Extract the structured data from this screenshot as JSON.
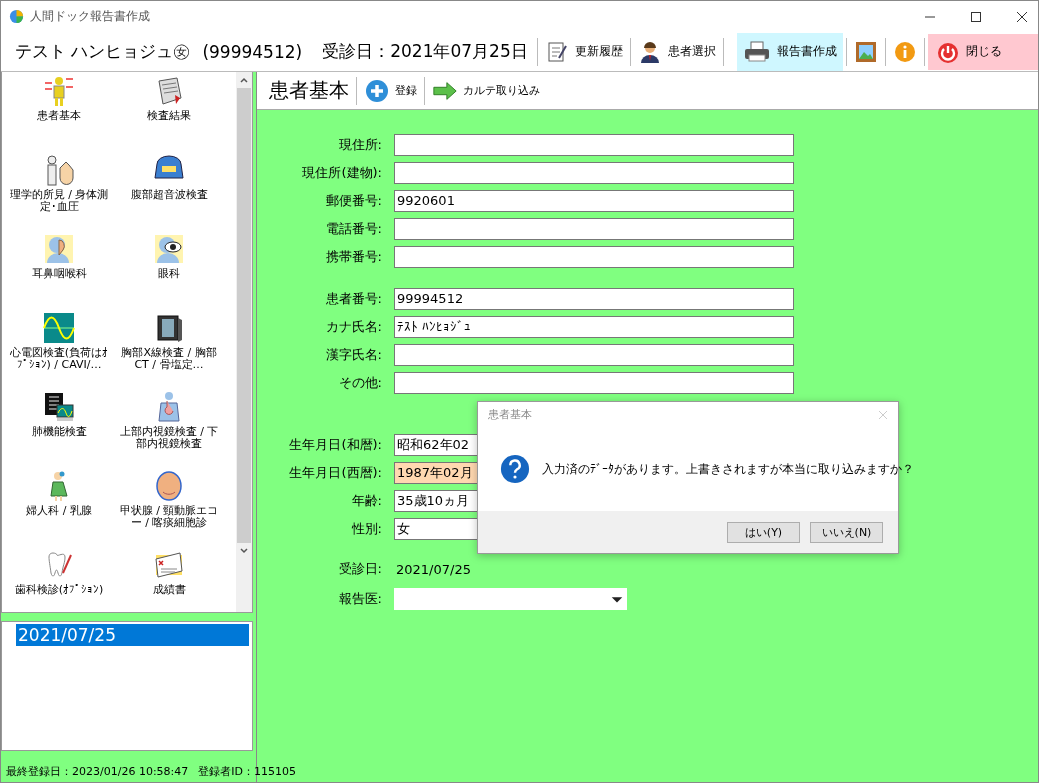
{
  "window": {
    "title": "人間ドック報告書作成"
  },
  "header": {
    "patient_name": "テスト ハンヒョジュ㊛",
    "patient_id": "(99994512)",
    "visit_date": "受診日：2021年07月25日",
    "buttons": [
      {
        "kind": "history",
        "label": "更新履歴"
      },
      {
        "kind": "patient",
        "label": "患者選択"
      },
      {
        "kind": "report",
        "label": "報告書作成"
      },
      {
        "kind": "picture"
      },
      {
        "kind": "info"
      },
      {
        "kind": "close",
        "label": "閉じる"
      }
    ]
  },
  "menu": [
    {
      "label": "患者基本"
    },
    {
      "label": "検査結果"
    },
    {
      "label": "理学的所見 / 身体測定･血圧"
    },
    {
      "label": "腹部超音波検査"
    },
    {
      "label": "耳鼻咽喉科"
    },
    {
      "label": "眼科"
    },
    {
      "label": "心電図検査(負荷はｵﾌﾟｼｮﾝ) / CAVI/…"
    },
    {
      "label": "胸部X線検査 / 胸部CT / 骨塩定…"
    },
    {
      "label": "肺機能検査"
    },
    {
      "label": "上部内視鏡検査 / 下部内視鏡検査"
    },
    {
      "label": "婦人科 / 乳腺"
    },
    {
      "label": "甲状腺 / 頸動脈エコー / 喀痰細胞診"
    },
    {
      "label": "歯科検診(ｵﾌﾟｼｮﾝ)"
    },
    {
      "label": "成績書"
    }
  ],
  "dates": [
    {
      "label": "2021/07/25",
      "selected": true
    }
  ],
  "status_bar": {
    "last_saved": "最終登録日：2023/01/26 10:58:47",
    "user_id": "登録者ID：115105"
  },
  "toolbar": {
    "title": "患者基本",
    "buttons": [
      {
        "kind": "add",
        "label": "登録"
      },
      {
        "kind": "import",
        "label": "カルテ取り込み"
      }
    ]
  },
  "form": {
    "sections": [
      [
        {
          "kind": "input",
          "label": "現住所:",
          "highlighted": false
        },
        {
          "kind": "input",
          "label": "現住所(建物):",
          "highlighted": false
        },
        {
          "kind": "input",
          "label": "郵便番号:",
          "value": "9920601",
          "highlighted": false
        },
        {
          "kind": "input",
          "label": "電話番号:",
          "highlighted": false
        },
        {
          "kind": "input",
          "label": "携帯番号:",
          "highlighted": false
        }
      ],
      [
        {
          "kind": "input",
          "label": "患者番号:",
          "value": "99994512",
          "highlighted": false
        },
        {
          "kind": "input",
          "label": "カナ氏名:",
          "value": "ﾃｽﾄ ﾊﾝﾋｮｼﾞｭ",
          "highlighted": false
        },
        {
          "kind": "input",
          "label": "漢字氏名:",
          "highlighted": false
        },
        {
          "kind": "input",
          "label": "その他:",
          "highlighted": false
        }
      ],
      [
        {
          "kind": "input",
          "label": "生年月日(和暦):",
          "value": "昭和62年02",
          "highlighted": false
        },
        {
          "kind": "input",
          "label": "生年月日(西暦):",
          "value": "1987年02月",
          "highlighted": true
        },
        {
          "kind": "input",
          "label": "年齢:",
          "value": "35歳10ヵ月",
          "highlighted": false
        },
        {
          "kind": "input",
          "label": "性別:",
          "value": "女",
          "highlighted": false
        }
      ],
      [
        {
          "kind": "text",
          "label": "受診日:",
          "value": "2021/07/25"
        }
      ],
      [
        {
          "kind": "select",
          "label": "報告医:"
        }
      ]
    ]
  },
  "dialog": {
    "title": "患者基本",
    "message": "入力済のﾃﾞｰﾀがあります。上書きされますが本当に取り込みますか？",
    "buttons": [
      "はい(Y)",
      "いいえ(N)"
    ]
  }
}
